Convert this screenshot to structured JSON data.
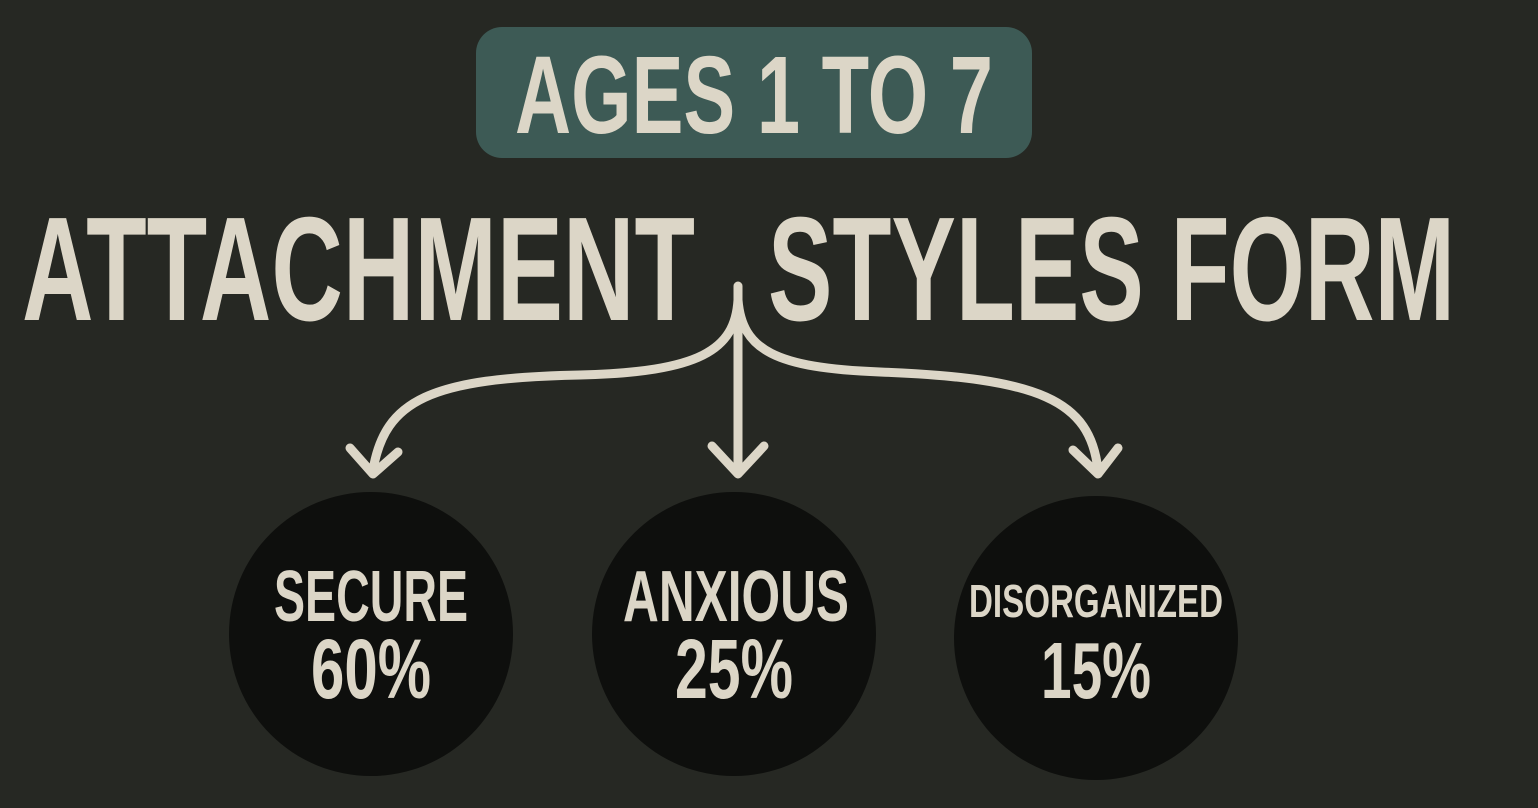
{
  "badge": {
    "text": "AGES 1 TO 7",
    "color": "#3d5a55"
  },
  "title": {
    "part1": "ATTACHMENT",
    "part2": "STYLES FORM"
  },
  "colors": {
    "background": "#262823",
    "text": "#dcd6c7",
    "circle": "#0e0f0d",
    "arrow": "#dcd6c7"
  },
  "styles": [
    {
      "label": "SECURE",
      "percent": "60%",
      "value": 60
    },
    {
      "label": "ANXIOUS",
      "percent": "25%",
      "value": 25
    },
    {
      "label": "DISORGANIZED",
      "percent": "15%",
      "value": 15
    }
  ]
}
